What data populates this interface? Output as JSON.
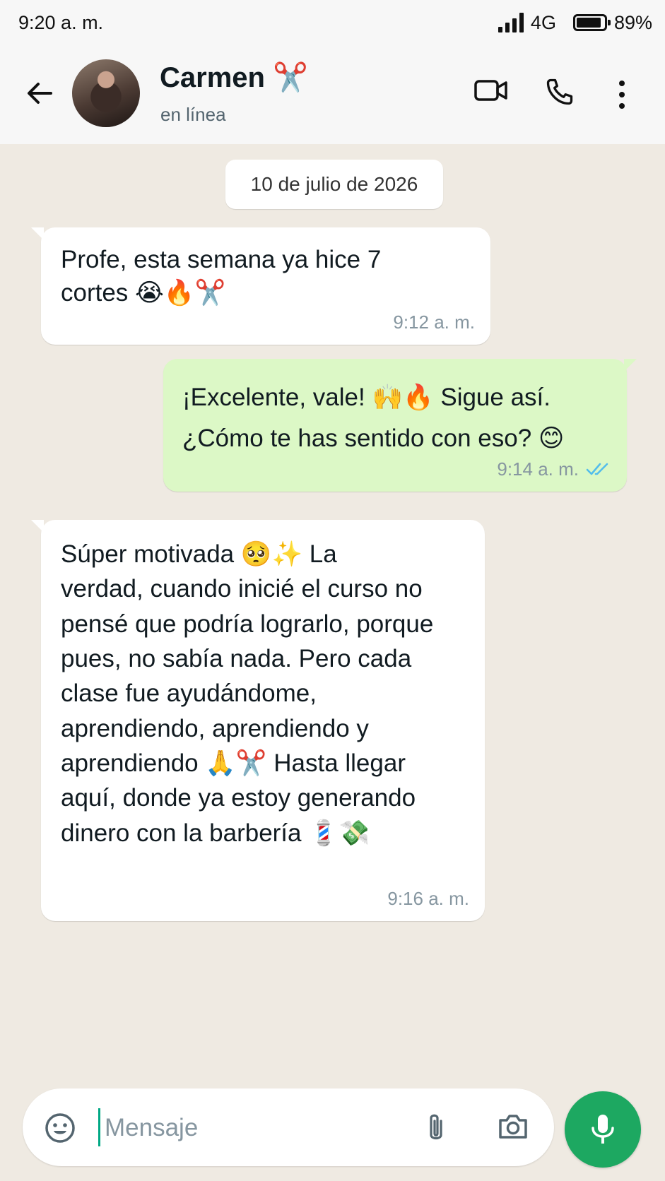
{
  "status_bar": {
    "time": "9:20 a. m.",
    "network": "4G",
    "battery": "89%",
    "battery_level": 0.89
  },
  "header": {
    "contact_name": "Carmen ✂️",
    "contact_status": "en línea",
    "icons": [
      "back-arrow-icon",
      "video-call-icon",
      "phone-call-icon",
      "more-options-icon"
    ]
  },
  "chat": {
    "date": "10 de julio de 2026",
    "messages": [
      {
        "direction": "in",
        "text": "Profe, esta semana ya hice 7\ncortes 😭🔥✂️",
        "time": "9:12 a. m."
      },
      {
        "direction": "out",
        "text": "¡Excelente, vale! 🙌🔥 Sigue así.\n¿Cómo te has sentido con eso? 😊",
        "time": "9:14 a. m.",
        "status": "read"
      },
      {
        "direction": "in",
        "text": "Súper motivada 🥺✨ La\nverdad, cuando inicié el curso no\npensé que podría lograrlo, porque\npues, no sabía nada. Pero cada\nclase fue ayudándome,\naprendiendo, aprendiendo y\naprendiendo 🙏✂️ Hasta llegar\naquí, donde ya estoy generando\ndinero con la barbería 💈💸",
        "time": "9:16 a. m."
      }
    ]
  },
  "composer": {
    "placeholder": "Mensaje",
    "icons": [
      "emoji-icon",
      "attach-icon",
      "camera-icon",
      "mic-icon"
    ]
  },
  "colors": {
    "chat_background": "#efeae2",
    "incoming_bubble": "#ffffff",
    "outgoing_bubble": "#dcf8c6",
    "accent_green": "#1da861",
    "read_ticks": "#53bdeb"
  }
}
